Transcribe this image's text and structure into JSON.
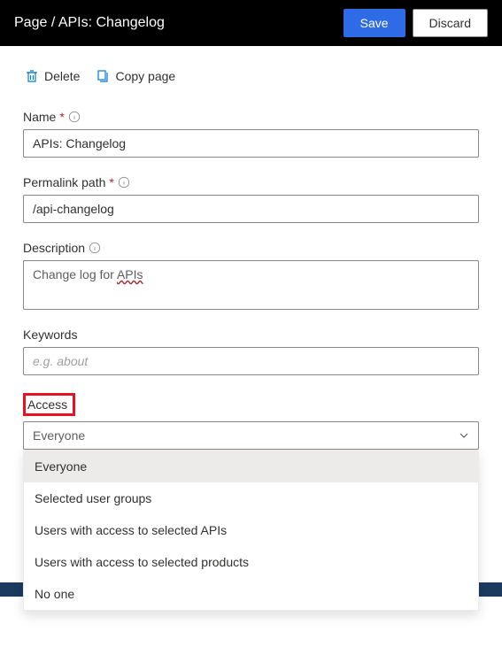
{
  "header": {
    "title": "Page / APIs: Changelog",
    "save_label": "Save",
    "discard_label": "Discard"
  },
  "toolbar": {
    "delete_label": "Delete",
    "copy_label": "Copy page"
  },
  "form": {
    "name": {
      "label": "Name",
      "value": "APIs: Changelog"
    },
    "permalink": {
      "label": "Permalink path",
      "value": "/api-changelog"
    },
    "description": {
      "label": "Description",
      "value_prefix": "Change log for ",
      "value_underlined": "APIs"
    },
    "keywords": {
      "label": "Keywords",
      "placeholder": "e.g. about"
    },
    "access": {
      "label": "Access",
      "selected": "Everyone",
      "options": [
        "Everyone",
        "Selected user groups",
        "Users with access to selected APIs",
        "Users with access to selected products",
        "No one"
      ]
    }
  }
}
